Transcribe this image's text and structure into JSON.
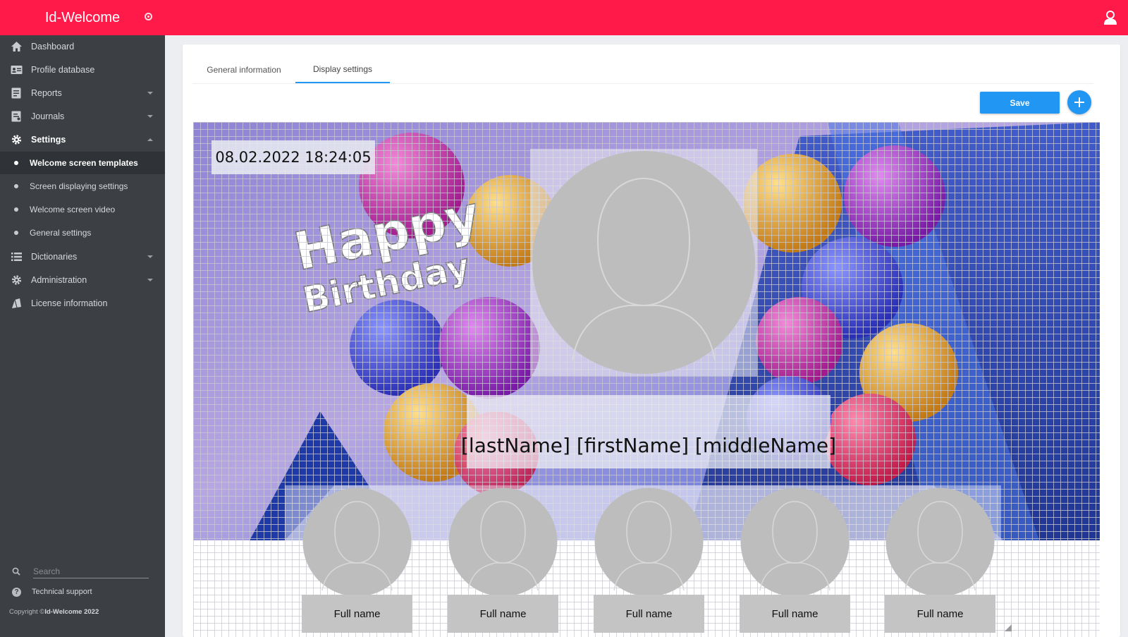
{
  "app": {
    "title": "Id-Welcome"
  },
  "colors": {
    "header": "#ff1a4a",
    "sidebar": "#3c3f44",
    "accent": "#2196f3"
  },
  "sidebar": {
    "items": [
      {
        "label": "Dashboard",
        "icon": "home-icon"
      },
      {
        "label": "Profile database",
        "icon": "id-card-icon"
      },
      {
        "label": "Reports",
        "icon": "report-icon"
      },
      {
        "label": "Journals",
        "icon": "journal-icon"
      },
      {
        "label": "Settings",
        "icon": "gear-icon"
      },
      {
        "label": "Dictionaries",
        "icon": "list-icon"
      },
      {
        "label": "Administration",
        "icon": "admin-gear-icon"
      },
      {
        "label": "License information",
        "icon": "license-icon"
      }
    ],
    "settings_children": [
      {
        "label": "Welcome screen templates"
      },
      {
        "label": "Screen displaying settings"
      },
      {
        "label": "Welcome screen video"
      },
      {
        "label": "General settings"
      }
    ],
    "search_placeholder": "Search",
    "support": "Technical support",
    "copyright_prefix": "Copyright ©",
    "copyright_brand": "Id-Welcome 2022"
  },
  "tabs": [
    {
      "label": "General information"
    },
    {
      "label": "Display settings"
    }
  ],
  "toolbar": {
    "save_label": "Save"
  },
  "template": {
    "background_text_1": "Happy",
    "background_text_2": "Birthday",
    "datetime": "08.02.2022 18:24:05",
    "name_placeholder": "[lastName] [firstName] [middleName]",
    "guests": [
      {
        "label": "Full name"
      },
      {
        "label": "Full name"
      },
      {
        "label": "Full name"
      },
      {
        "label": "Full name"
      },
      {
        "label": "Full name"
      }
    ]
  }
}
